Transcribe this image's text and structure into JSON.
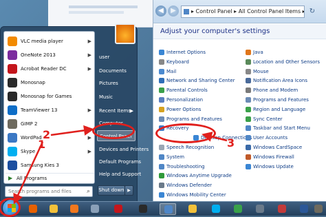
{
  "start_menu": {
    "programs": [
      {
        "label": "VLC media player",
        "icon": "vlc-icon",
        "color": "#f28a00",
        "has_arrow": true
      },
      {
        "label": "OneNote 2013",
        "icon": "onenote-icon",
        "color": "#7b2c9e",
        "has_arrow": true
      },
      {
        "label": "Acrobat Reader DC",
        "icon": "acrobat-icon",
        "color": "#c4161c",
        "has_arrow": true
      },
      {
        "label": "Monosnap",
        "icon": "monosnap-icon",
        "color": "#2a2a2a",
        "has_arrow": false
      },
      {
        "label": "Monosnap for Games",
        "icon": "monosnap-games-icon",
        "color": "#2a2a2a",
        "has_arrow": false
      },
      {
        "label": "TeamViewer 13",
        "icon": "teamviewer-icon",
        "color": "#0e6ec7",
        "has_arrow": true
      },
      {
        "label": "GIMP 2",
        "icon": "gimp-icon",
        "color": "#6e6a5e",
        "has_arrow": false
      },
      {
        "label": "WordPad",
        "icon": "wordpad-icon",
        "color": "#3b78c4",
        "has_arrow": true
      },
      {
        "label": "Skype",
        "icon": "skype-icon",
        "color": "#00aff0",
        "has_arrow": true
      },
      {
        "label": "Samsung Kies 3",
        "icon": "kies-icon",
        "color": "#1c4fa0",
        "has_arrow": false
      }
    ],
    "all_programs": "All Programs",
    "search_placeholder": "Search programs and files",
    "right_items": [
      {
        "label": "user",
        "has_arrow": false
      },
      {
        "label": "Documents",
        "has_arrow": false
      },
      {
        "label": "Pictures",
        "has_arrow": false
      },
      {
        "label": "Music",
        "has_arrow": false
      },
      {
        "label": "Recent Items",
        "has_arrow": true
      },
      {
        "label": "Computer",
        "has_arrow": false
      },
      {
        "label": "Control Panel",
        "has_arrow": false
      },
      {
        "label": "Devices and Printers",
        "has_arrow": false
      },
      {
        "label": "Default Programs",
        "has_arrow": false
      },
      {
        "label": "Help and Support",
        "has_arrow": false
      }
    ],
    "shutdown_label": "Shut down"
  },
  "control_panel": {
    "address": "▸ Control Panel ▸ All Control Panel Items ▸",
    "heading": "Adjust your computer's settings",
    "left_column": [
      {
        "label": "Internet Options",
        "color": "#3a86d4"
      },
      {
        "label": "Keyboard",
        "color": "#888888"
      },
      {
        "label": "Mail",
        "color": "#4b8ad0"
      },
      {
        "label": "Network and Sharing Center",
        "color": "#2f6fb8"
      },
      {
        "label": "Parental Controls",
        "color": "#3ba04a"
      },
      {
        "label": "Personalization",
        "color": "#5a7fc0"
      },
      {
        "label": "Power Options",
        "color": "#d6a21f"
      },
      {
        "label": "Programs and Features",
        "color": "#6b8bb5"
      },
      {
        "label": "Recovery",
        "color": "#3d7ac9"
      },
      {
        "label": "Desktop Connections",
        "color": "#3a86d4"
      },
      {
        "label": "Speech Recognition",
        "color": "#9aa6b4"
      },
      {
        "label": "System",
        "color": "#4f86c6"
      },
      {
        "label": "Troubleshooting",
        "color": "#4f86c6"
      },
      {
        "label": "Windows Anytime Upgrade",
        "color": "#2f9a3a"
      },
      {
        "label": "Windows Defender",
        "color": "#6a7a8a"
      },
      {
        "label": "Windows Mobility Center",
        "color": "#3a86d4"
      }
    ],
    "right_column": [
      {
        "label": "Java",
        "color": "#e0761b"
      },
      {
        "label": "Location and Other Sensors",
        "color": "#5a8a5a"
      },
      {
        "label": "Mouse",
        "color": "#888888"
      },
      {
        "label": "Notification Area Icons",
        "color": "#4a6a9a"
      },
      {
        "label": "Phone and Modem",
        "color": "#7a7a7a"
      },
      {
        "label": "Programs and Features",
        "color": "#6b8bb5"
      },
      {
        "label": "Region and Language",
        "color": "#3aa24a"
      },
      {
        "label": "Sync Center",
        "color": "#3ba04a"
      },
      {
        "label": "Taskbar and Start Menu",
        "color": "#4f86c6"
      },
      {
        "label": "User Accounts",
        "color": "#4f86c6"
      },
      {
        "label": "Windows CardSpace",
        "color": "#3a6aa8"
      },
      {
        "label": "Windows Firewall",
        "color": "#c05a2a"
      },
      {
        "label": "Windows Update",
        "color": "#3a86d4"
      }
    ]
  },
  "taskbar": {
    "items": [
      {
        "name": "firefox-taskbar-icon",
        "color": "#e66000"
      },
      {
        "name": "explorer-taskbar-icon",
        "color": "#f3c13a"
      },
      {
        "name": "media-player-taskbar-icon",
        "color": "#f2781e"
      },
      {
        "name": "recorder-taskbar-icon",
        "color": "#8aa0b8"
      },
      {
        "name": "acrobat-taskbar-icon",
        "color": "#c4161c"
      },
      {
        "name": "monosnap-taskbar-icon",
        "color": "#2a2a2a"
      },
      {
        "name": "control-panel-taskbar-icon",
        "color": "#4f86c6"
      },
      {
        "name": "folder-taskbar-icon",
        "color": "#f3c13a"
      },
      {
        "name": "skype-taskbar-icon",
        "color": "#00aff0"
      },
      {
        "name": "chrome-taskbar-icon",
        "color": "#3aa24a"
      },
      {
        "name": "settings-taskbar-icon",
        "color": "#6a7a8a"
      },
      {
        "name": "screenshot-taskbar-icon",
        "color": "#c23a3a"
      },
      {
        "name": "word-taskbar-icon",
        "color": "#2b5797"
      },
      {
        "name": "gimp-taskbar-icon",
        "color": "#6e6a5e"
      }
    ]
  },
  "annotations": {
    "step1": "1",
    "step2": "2",
    "step3": "3",
    "color": "#e0201d"
  }
}
